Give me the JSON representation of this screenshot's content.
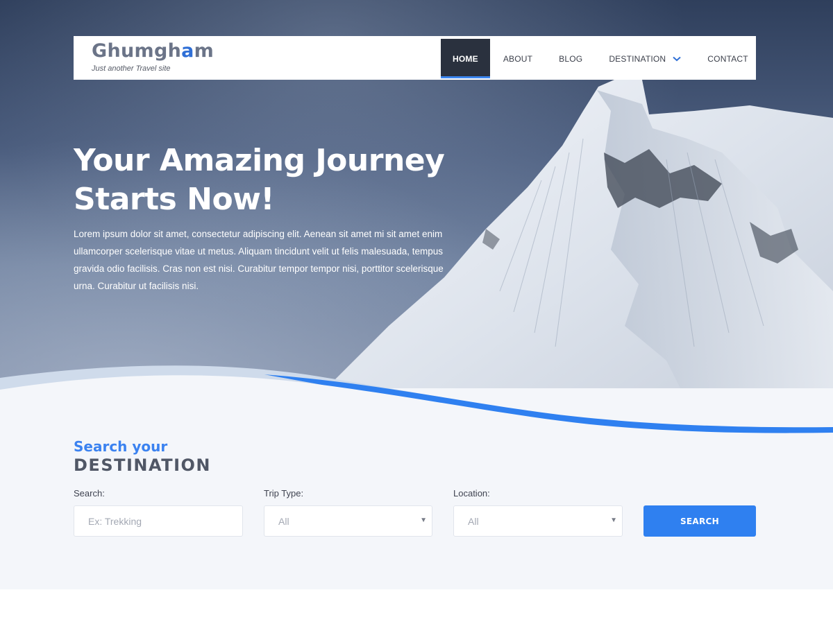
{
  "brand": {
    "title_main": "Ghumgh",
    "title_accent": "a",
    "title_end": "m",
    "tagline": "Just another Travel site"
  },
  "nav": {
    "items": [
      {
        "label": "HOME",
        "active": true
      },
      {
        "label": "ABOUT",
        "active": false
      },
      {
        "label": "BLOG",
        "active": false
      },
      {
        "label": "DESTINATION",
        "active": false,
        "icon": "chevron-down-icon"
      },
      {
        "label": "CONTACT",
        "active": false
      }
    ]
  },
  "hero": {
    "title_line1": "Your Amazing Journey",
    "title_line2": "Starts Now!",
    "description": "Lorem ipsum dolor sit amet, consectetur adipiscing elit. Aenean sit amet mi sit amet enim ullamcorper scelerisque vitae ut metus. Aliquam tincidunt velit ut felis malesuada, tempus gravida odio facilisis. Cras non est nisi. Curabitur tempor tempor nisi, porttitor scelerisque urna. Curabitur ut facilisis nisi."
  },
  "search": {
    "heading_top": "Search your",
    "heading_bottom": "DESTINATION",
    "search_label": "Search:",
    "search_placeholder": "Ex: Trekking",
    "trip_label": "Trip Type:",
    "trip_value": "All",
    "location_label": "Location:",
    "location_value": "All",
    "button_label": "SEARCH"
  },
  "colors": {
    "accent": "#2f80f0",
    "nav_active_bg": "#2a313e",
    "heading_dark": "#505766"
  }
}
